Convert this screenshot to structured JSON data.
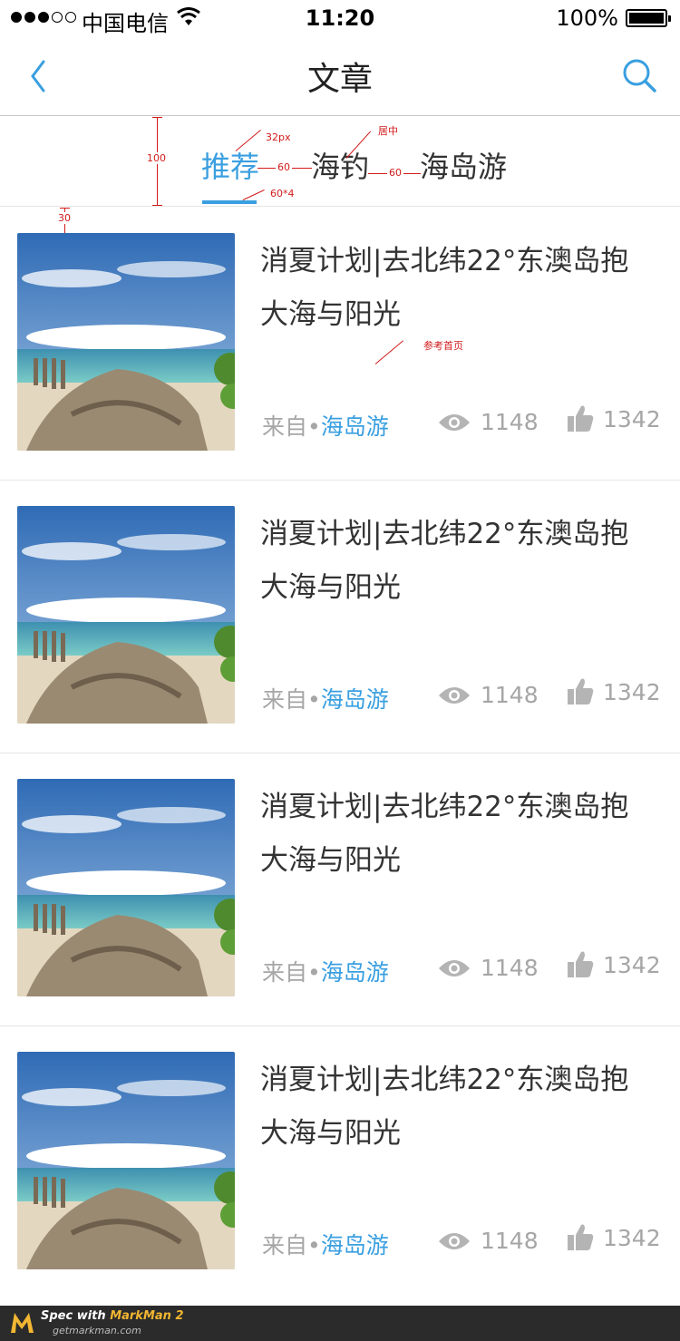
{
  "status_bar": {
    "carrier": "中国电信",
    "time": "11:20",
    "battery": "100%"
  },
  "nav": {
    "title": "文章",
    "back_icon": "chevron-left-icon",
    "search_icon": "search-icon"
  },
  "tabs": [
    {
      "label": "推荐",
      "active": true
    },
    {
      "label": "海钓",
      "active": false
    },
    {
      "label": "海岛游",
      "active": false
    }
  ],
  "annotations": {
    "tab_height": "100",
    "font_size": "32px",
    "gap_a": "60",
    "gap_b": "60",
    "center": "居中",
    "indicator": "60*4",
    "top_margin": "30",
    "ref": "参考首页"
  },
  "articles": [
    {
      "title_line1": "消夏计划|去北纬22°东澳岛抱",
      "title_line2": "大海与阳光",
      "from_label": "来自•",
      "source": "海岛游",
      "views": "1148",
      "likes": "1342"
    },
    {
      "title_line1": "消夏计划|去北纬22°东澳岛抱",
      "title_line2": "大海与阳光",
      "from_label": "来自•",
      "source": "海岛游",
      "views": "1148",
      "likes": "1342"
    },
    {
      "title_line1": "消夏计划|去北纬22°东澳岛抱",
      "title_line2": "大海与阳光",
      "from_label": "来自•",
      "source": "海岛游",
      "views": "1148",
      "likes": "1342"
    },
    {
      "title_line1": "消夏计划|去北纬22°东澳岛抱",
      "title_line2": "大海与阳光",
      "from_label": "来自•",
      "source": "海岛游",
      "views": "1148",
      "likes": "1342"
    }
  ],
  "footer": {
    "line1_prefix": "Spec with ",
    "line1_brand": "MarkMan 2",
    "line2": "getmarkman.com"
  },
  "colors": {
    "accent": "#3a9fe0",
    "annotation": "#d21a1a"
  }
}
